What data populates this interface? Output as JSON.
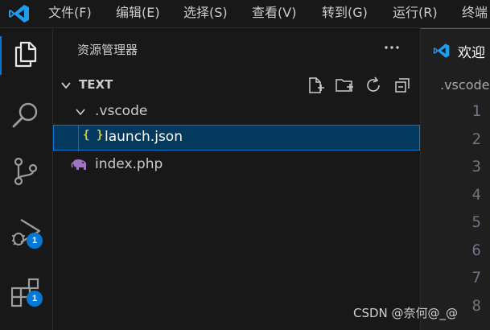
{
  "menu": {
    "items": [
      "文件(F)",
      "编辑(E)",
      "选择(S)",
      "查看(V)",
      "转到(G)",
      "运行(R)",
      "终端"
    ]
  },
  "activity_bar": {
    "items": [
      {
        "icon": "files-icon",
        "active": true
      },
      {
        "icon": "search-icon"
      },
      {
        "icon": "source-control-icon"
      },
      {
        "icon": "run-debug-icon",
        "badge": "1"
      },
      {
        "icon": "extensions-icon",
        "badge": "1"
      }
    ]
  },
  "sidebar": {
    "title": "资源管理器",
    "more_label": "···",
    "section": {
      "title": "TEXT",
      "actions": [
        "new-file-icon",
        "new-folder-icon",
        "refresh-icon",
        "collapse-all-icon"
      ]
    },
    "tree": [
      {
        "label": ".vscode",
        "type": "folder",
        "expanded": true
      },
      {
        "label": "launch.json",
        "type": "file",
        "icon_text": "{ }",
        "selected": true
      },
      {
        "label": "index.php",
        "type": "file",
        "icon": "php-elephant-icon"
      }
    ]
  },
  "editor": {
    "tab_label": "欢迎",
    "breadcrumb": ".vscode",
    "line_numbers": [
      "1",
      "2",
      "3",
      "4",
      "5",
      "6",
      "7",
      "8"
    ]
  },
  "watermark": "CSDN @奈何@_@",
  "colors": {
    "accent": "#0078d4",
    "selection": "#04395e",
    "json_icon": "#cbcb41",
    "php_icon": "#a074c4",
    "background": "#1f1f1f",
    "sidebar": "#181818"
  }
}
